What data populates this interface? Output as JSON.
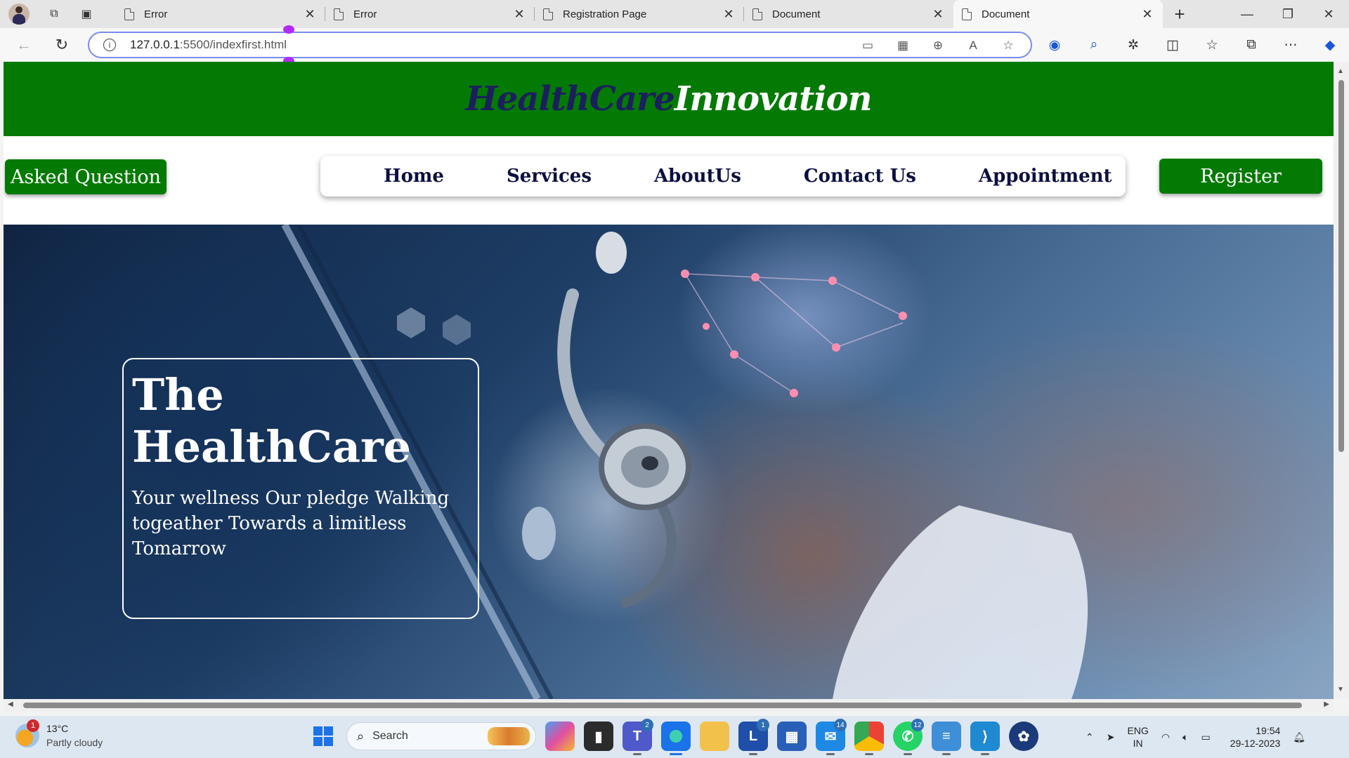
{
  "browser": {
    "tabs": [
      {
        "title": "Error",
        "active": false
      },
      {
        "title": "Error",
        "active": false
      },
      {
        "title": "Registration Page",
        "active": false
      },
      {
        "title": "Document",
        "active": false
      },
      {
        "title": "Document",
        "active": true
      }
    ],
    "url_host": "127.0.0.1",
    "url_rest": ":5500/indexfirst.html"
  },
  "site": {
    "logo_part1": "HealthCare",
    "logo_part2": "Innovation",
    "asked_question": "Asked Question",
    "nav": [
      "Home",
      "Services",
      "AboutUs",
      "Contact Us",
      "Appointment"
    ],
    "register": "Register",
    "hero": {
      "title_line1": "The",
      "title_line2": "HealthCare",
      "subtitle": "Your wellness Our pledge Walking togeather Towards a limitless Tomarrow"
    },
    "colors": {
      "header_green": "#037a03",
      "logo_dark": "#1c1f5e",
      "nav_text": "#0c0f3f"
    }
  },
  "taskbar": {
    "weather_badge": "1",
    "weather_temp": "13°C",
    "weather_desc": "Partly cloudy",
    "search_label": "Search",
    "app_badges": {
      "teams": "2",
      "l_app": "1",
      "mail": "14",
      "whatsapp": "12"
    },
    "lang_top": "ENG",
    "lang_bottom": "IN",
    "time": "19:54",
    "date": "29-12-2023"
  }
}
